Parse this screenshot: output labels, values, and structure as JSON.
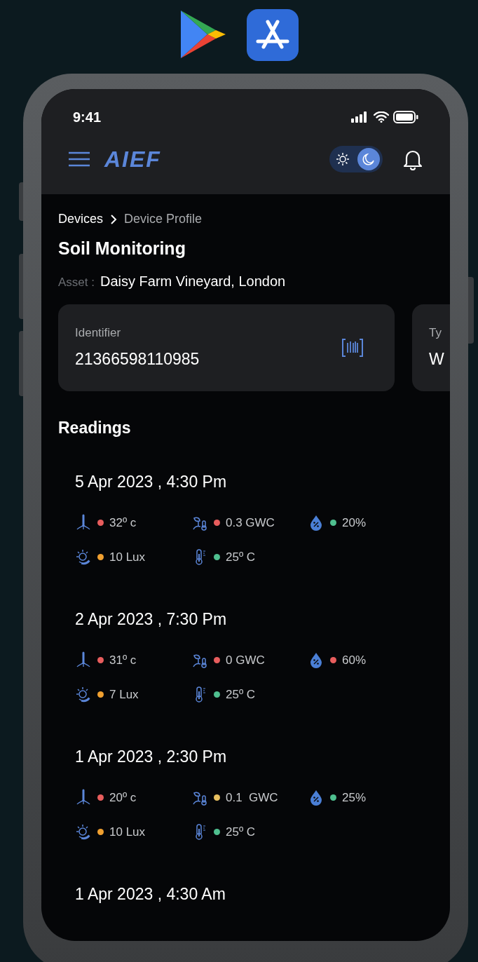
{
  "store_badges": [
    {
      "kind": "play"
    },
    {
      "kind": "appstore"
    }
  ],
  "status_bar": {
    "time": "9:41"
  },
  "header": {
    "logo": "AIEF",
    "dark_mode": true
  },
  "breadcrumb": [
    {
      "label": "Devices",
      "current": false
    },
    {
      "label": "Device Profile",
      "current": true
    }
  ],
  "title": "Soil Monitoring",
  "asset": {
    "label": "Asset :",
    "value": "Daisy Farm Vineyard, London"
  },
  "cards": [
    {
      "label": "Identifier",
      "value": "21366598110985",
      "kind": "scannable"
    },
    {
      "label": "Ty",
      "value": "W",
      "kind": "plain"
    }
  ],
  "readings_title": "Readings",
  "readings": [
    {
      "date": "5 Apr 2023 , 4:30 Pm",
      "metrics": [
        {
          "kind": "soil_temp",
          "value": "32º c",
          "color": "#e85d5d"
        },
        {
          "kind": "gwc",
          "value": "0.3 GWC",
          "color": "#e85d5d"
        },
        {
          "kind": "humidity",
          "value": "20%",
          "color": "#4fbf8f"
        },
        {
          "kind": "light",
          "value": "10 Lux",
          "color": "#f0a030"
        },
        {
          "kind": "temp",
          "value": "25º C",
          "color": "#4fbf8f"
        }
      ]
    },
    {
      "date": "2 Apr 2023 , 7:30 Pm",
      "metrics": [
        {
          "kind": "soil_temp",
          "value": "31º c",
          "color": "#e85d5d"
        },
        {
          "kind": "gwc",
          "value": "0 GWC",
          "color": "#e85d5d"
        },
        {
          "kind": "humidity",
          "value": "60%",
          "color": "#e85d5d"
        },
        {
          "kind": "light",
          "value": "7 Lux",
          "color": "#f0a030"
        },
        {
          "kind": "temp",
          "value": "25º C",
          "color": "#4fbf8f"
        }
      ]
    },
    {
      "date": "1 Apr 2023 , 2:30 Pm",
      "metrics": [
        {
          "kind": "soil_temp",
          "value": "20º c",
          "color": "#e85d5d"
        },
        {
          "kind": "gwc",
          "value": "0.1  GWC",
          "color": "#e8c060"
        },
        {
          "kind": "humidity",
          "value": "25%",
          "color": "#4fbf8f"
        },
        {
          "kind": "light",
          "value": "10 Lux",
          "color": "#f0a030"
        },
        {
          "kind": "temp",
          "value": "25º C",
          "color": "#4fbf8f"
        }
      ]
    },
    {
      "date": "1 Apr 2023 , 4:30 Am"
    }
  ]
}
